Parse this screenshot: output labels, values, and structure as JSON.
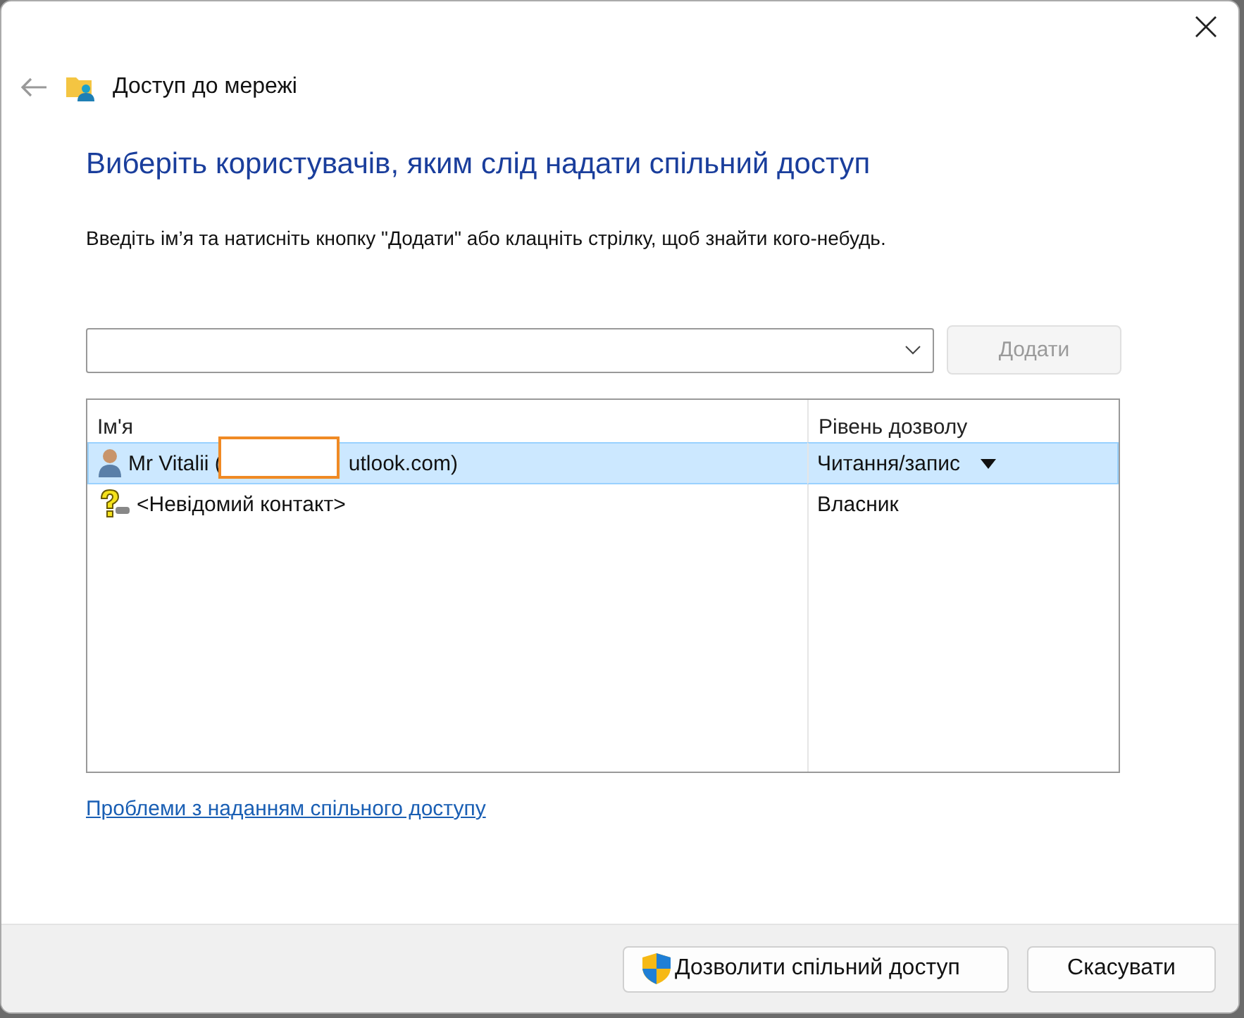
{
  "window": {
    "title": "Доступ до мережі"
  },
  "heading": "Виберіть користувачів, яким слід надати спільний доступ",
  "instruction": "Введіть ім’я та натисніть кнопку \"Додати\" або клацніть стрілку, щоб знайти кого-небудь.",
  "add_button": {
    "label": "Додати",
    "disabled": true
  },
  "table": {
    "columns": [
      "Ім'я",
      "Рівень дозволу"
    ],
    "rows": [
      {
        "kind": "user",
        "name_before": "Mr Vitalii (",
        "redacted": true,
        "name_after": "utlook.com)",
        "permission": "Читання/запис",
        "has_dropdown": true,
        "selected": true
      },
      {
        "kind": "unknown",
        "name_before": "<Невідомий контакт>",
        "redacted": false,
        "name_after": "",
        "permission": "Власник",
        "has_dropdown": false,
        "selected": false
      }
    ]
  },
  "help_link": "Проблеми з наданням спільного доступу",
  "buttons": [
    {
      "kind": "shield",
      "label": "Дозволити спільний доступ"
    },
    {
      "kind": "plain",
      "label": "Скасувати"
    }
  ]
}
